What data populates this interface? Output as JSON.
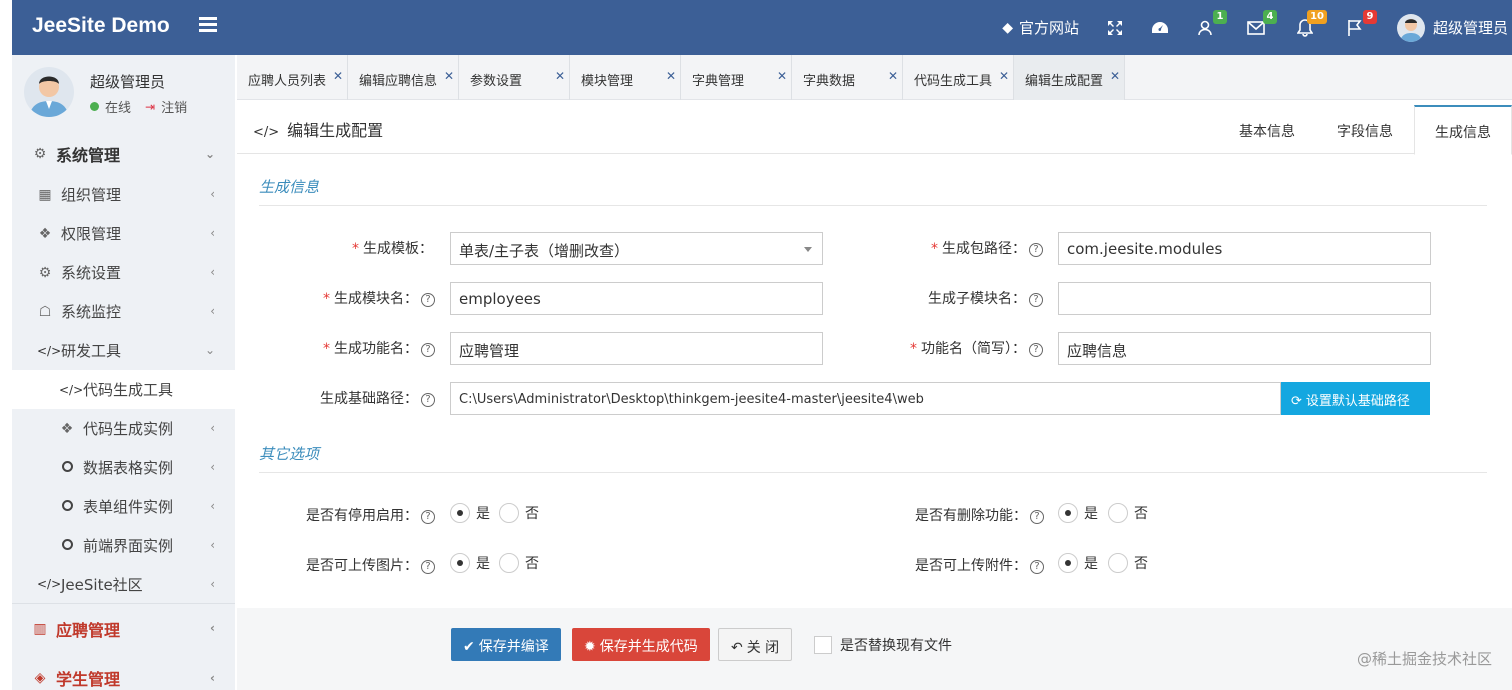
{
  "app": {
    "title": "JeeSite Demo"
  },
  "topnav": {
    "official_site": "官方网站",
    "badges": {
      "users": "1",
      "mail": "4",
      "bell": "10",
      "flag": "9"
    },
    "user": "超级管理员"
  },
  "sidebar": {
    "user": {
      "name": "超级管理员",
      "status": "在线",
      "logout": "注销"
    },
    "items": [
      {
        "label": "系统管理"
      },
      {
        "label": "组织管理"
      },
      {
        "label": "权限管理"
      },
      {
        "label": "系统设置"
      },
      {
        "label": "系统监控"
      },
      {
        "label": "研发工具"
      },
      {
        "label": "代码生成工具"
      },
      {
        "label": "代码生成实例"
      },
      {
        "label": "数据表格实例"
      },
      {
        "label": "表单组件实例"
      },
      {
        "label": "前端界面实例"
      },
      {
        "label": "JeeSite社区"
      },
      {
        "label": "应聘管理"
      },
      {
        "label": "学生管理"
      }
    ]
  },
  "tabs": [
    {
      "label": "应聘人员列表"
    },
    {
      "label": "编辑应聘信息"
    },
    {
      "label": "参数设置"
    },
    {
      "label": "模块管理"
    },
    {
      "label": "字典管理"
    },
    {
      "label": "字典数据"
    },
    {
      "label": "代码生成工具"
    },
    {
      "label": "编辑生成配置"
    }
  ],
  "page": {
    "title": "编辑生成配置",
    "tabs": {
      "basic": "基本信息",
      "fields": "字段信息",
      "gen": "生成信息"
    }
  },
  "form": {
    "section_gen": "生成信息",
    "template_label": "生成模板：",
    "template_value": "单表/主子表（增删改查）",
    "package_label": "生成包路径：",
    "package_value": "com.jeesite.modules",
    "module_label": "生成模块名：",
    "module_value": "employees",
    "submodule_label": "生成子模块名：",
    "submodule_value": "",
    "function_label": "生成功能名：",
    "function_value": "应聘管理",
    "function_short_label": "功能名（简写）：",
    "function_short_value": "应聘信息",
    "basepath_label": "生成基础路径：",
    "basepath_value": "C:\\Users\\Administrator\\Desktop\\thinkgem-jeesite4-master\\jeesite4\\web",
    "set_default_button": "设置默认基础路径",
    "section_other": "其它选项",
    "enable_label": "是否有停用启用：",
    "delete_label": "是否有删除功能：",
    "upload_image_label": "是否可上传图片：",
    "upload_file_label": "是否可上传附件：",
    "yes": "是",
    "no": "否"
  },
  "actions": {
    "save_compile": "保存并编译",
    "save_generate": "保存并生成代码",
    "close": "关 闭",
    "replace_files": "是否替换现有文件"
  },
  "watermark": "@稀土掘金技术社区"
}
